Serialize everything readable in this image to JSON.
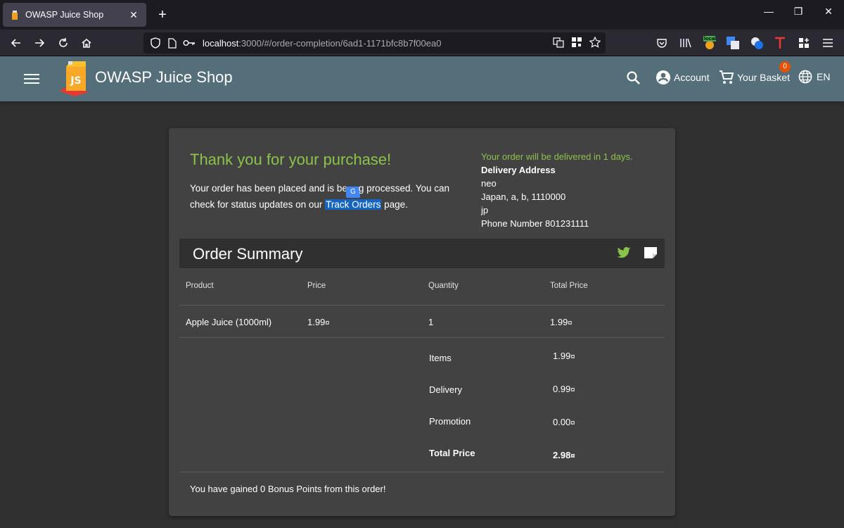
{
  "browser": {
    "tab_title": "OWASP Juice Shop",
    "url_host": "localhost",
    "url_path": ":3000/#/order-completion/6ad1-1171bfc8b7f00ea0",
    "ext_badge": "local"
  },
  "app": {
    "title": "OWASP Juice Shop",
    "account_label": "Account",
    "basket_label": "Your Basket",
    "basket_count": "0",
    "language": "EN"
  },
  "order": {
    "thanks": "Thank you for your purchase!",
    "placed_text_1": "Your order has been placed and is be",
    "placed_text_2": "g processed. You can check for status updates on our ",
    "track_link": "Track Orders",
    "placed_text_3": " page.",
    "eta": "Your order will be delivered in 1 days.",
    "delivery_label": "Delivery Address",
    "address_name": "neo",
    "address_line": "Japan, a, b, 1110000",
    "address_country": "jp",
    "phone": "Phone Number 801231111"
  },
  "summary": {
    "title": "Order Summary",
    "headers": [
      "Product",
      "Price",
      "Quantity",
      "Total Price"
    ],
    "rows": [
      {
        "product": "Apple Juice (1000ml)",
        "price": "1.99",
        "quantity": "1",
        "total": "1.99"
      }
    ],
    "currency_symbol": "¤",
    "items_label": "Items",
    "items_value": "1.99",
    "delivery_label": "Delivery",
    "delivery_value": "0.99",
    "promotion_label": "Promotion",
    "promotion_value": "0.00",
    "total_label": "Total Price",
    "total_value": "2.98",
    "bonus": "You have gained 0 Bonus Points from this order!"
  },
  "colors": {
    "toolbar": "#546e7a",
    "accent_green": "#8bc34a",
    "card": "#424242",
    "background": "#303030"
  }
}
